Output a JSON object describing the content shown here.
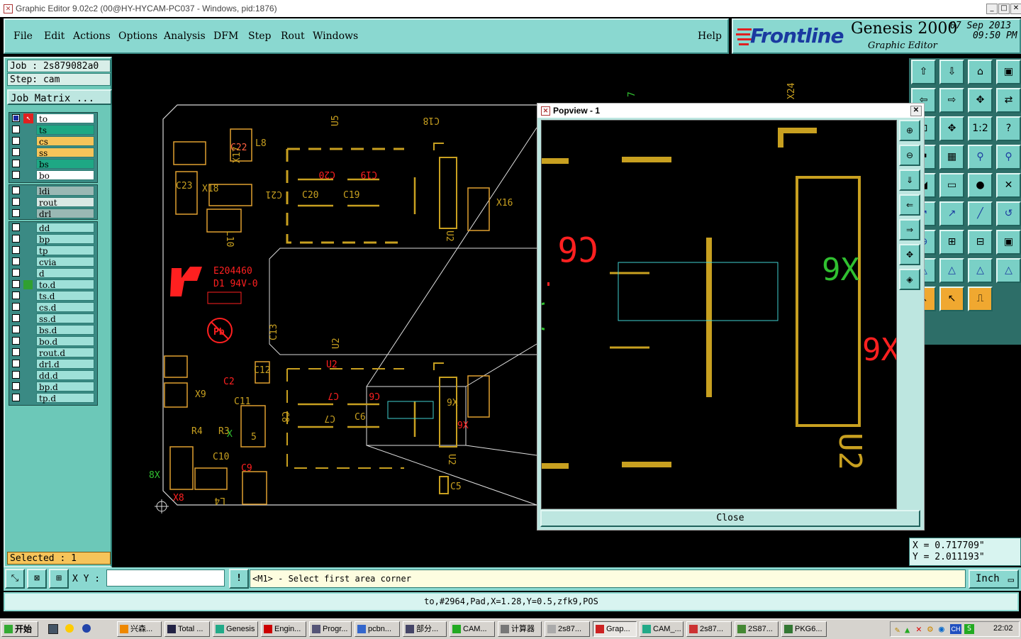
{
  "window": {
    "title": "Graphic Editor 9.02c2 (00@HY-HYCAM-PC037 - Windows, pid:1876)",
    "minimize": "_",
    "maximize": "□",
    "close": "✕"
  },
  "menu": {
    "items": [
      "File",
      "Edit",
      "Actions",
      "Options",
      "Analysis",
      "DFM",
      "Step",
      "Rout",
      "Windows"
    ],
    "help": "Help"
  },
  "brand": {
    "logo": "Frontline",
    "product": "Genesis 2000",
    "subtitle": "Graphic Editor",
    "date": "07 Sep 2013",
    "time": "09:50 PM"
  },
  "job": {
    "job": "Job : 2s879082a0",
    "step": "Step: cam",
    "matrix_button": "Job Matrix ..."
  },
  "layers": {
    "group1": [
      {
        "name": "to",
        "color": "#ffffff"
      },
      {
        "name": "ts",
        "color": "#1ea884"
      },
      {
        "name": "cs",
        "color": "#f6c45a"
      },
      {
        "name": "ss",
        "color": "#f6c45a"
      },
      {
        "name": "bs",
        "color": "#1ea884"
      },
      {
        "name": "bo",
        "color": "#ffffff"
      }
    ],
    "group2": [
      {
        "name": "ldi",
        "color": "#9ab8b4"
      },
      {
        "name": "rout",
        "color": "#d8e8e4"
      },
      {
        "name": "drl",
        "color": "#9ab8b4"
      }
    ],
    "group3": [
      {
        "name": "dd",
        "color": "#9ee0d8"
      },
      {
        "name": "bp",
        "color": "#9ee0d8"
      },
      {
        "name": "tp",
        "color": "#9ee0d8"
      },
      {
        "name": "cvia",
        "color": "#9ee0d8"
      },
      {
        "name": "d",
        "color": "#9ee0d8"
      },
      {
        "name": "to.d",
        "color": "#9ee0d8"
      },
      {
        "name": "ts.d",
        "color": "#9ee0d8"
      },
      {
        "name": "cs.d",
        "color": "#9ee0d8"
      },
      {
        "name": "ss.d",
        "color": "#9ee0d8"
      },
      {
        "name": "bs.d",
        "color": "#9ee0d8"
      },
      {
        "name": "bo.d",
        "color": "#9ee0d8"
      },
      {
        "name": "rout.d",
        "color": "#9ee0d8"
      },
      {
        "name": "drl.d",
        "color": "#9ee0d8"
      },
      {
        "name": "dd.d",
        "color": "#9ee0d8"
      },
      {
        "name": "bp.d",
        "color": "#9ee0d8"
      },
      {
        "name": "tp.d",
        "color": "#9ee0d8"
      }
    ],
    "selected": "Selected : 1"
  },
  "board": {
    "labels": [
      "C18",
      "U5",
      "L8",
      "C22",
      "X17",
      "C23",
      "X18",
      "C21",
      "C20",
      "C19",
      "C20",
      "C19",
      "X16",
      "U2",
      "L10",
      "E204460",
      "D1 94V-0",
      "C13",
      "U2",
      "U2",
      "C12",
      "C2",
      "X9",
      "C11",
      "C7",
      "C6",
      "C7",
      "C6",
      "9X",
      "9X",
      "C8",
      "R4",
      "R3",
      "C10",
      "C9",
      "X",
      "C5",
      "U2",
      "8X",
      "X8",
      "L4",
      "5"
    ]
  },
  "popview": {
    "title": "Popview - 1",
    "close_label": "Close",
    "labels": [
      "C6",
      "9X",
      "9X",
      "U2"
    ]
  },
  "toolbox": {
    "icons": [
      "move-up-icon",
      "move-down-icon",
      "home-icon",
      "window-icon",
      "move-left-icon",
      "move-right-icon",
      "move-icon",
      "copy-icon",
      "fit-icon",
      "pan-icon",
      "scale-1-2-icon",
      "help-icon",
      "layers-icon",
      "grid-icon",
      "snap-icon",
      "snap-alt-icon",
      "measure-icon",
      "ruler-icon",
      "circle-icon",
      "cross-icon",
      "line-point-icon",
      "line-point-alt-icon",
      "line-icon",
      "arc-icon",
      "pad-icon",
      "text-icon",
      "dim-icon",
      "group-icon",
      "triangle-icon",
      "triangle-red-icon",
      "triangle-up-icon",
      "triangle-blue-icon",
      "select-icon",
      "select-alt-icon",
      "route-icon"
    ],
    "scale_label": "1:2"
  },
  "coords": {
    "x": "X = 0.717709\"",
    "y": "Y = 2.011193\""
  },
  "command": {
    "xy_label": "X Y :",
    "xy_value": "",
    "prompt": "<M1> - Select first area corner",
    "units": "Inch",
    "info_button": "!"
  },
  "status": {
    "text": "to,#2964,Pad,X=1.28,Y=0.5,zfk9,POS"
  },
  "taskbar": {
    "start": "开始",
    "tasks": [
      "兴森...",
      "Total ...",
      "Genesis",
      "Engin...",
      "Progr...",
      "pcbn...",
      "部分...",
      "CAM...",
      "计算器",
      "2s87...",
      "Grap...",
      "CAM_...",
      "2s87...",
      "2S87...",
      "PKG6..."
    ],
    "tray": {
      "lang": "CH",
      "clock": "22:02"
    }
  },
  "colors": {
    "accent": "#8ad8d0",
    "silk": "#e8c040",
    "pad": "#b8960a",
    "red": "#ff2020",
    "green": "#30c030",
    "cyan": "#40d0d0"
  }
}
